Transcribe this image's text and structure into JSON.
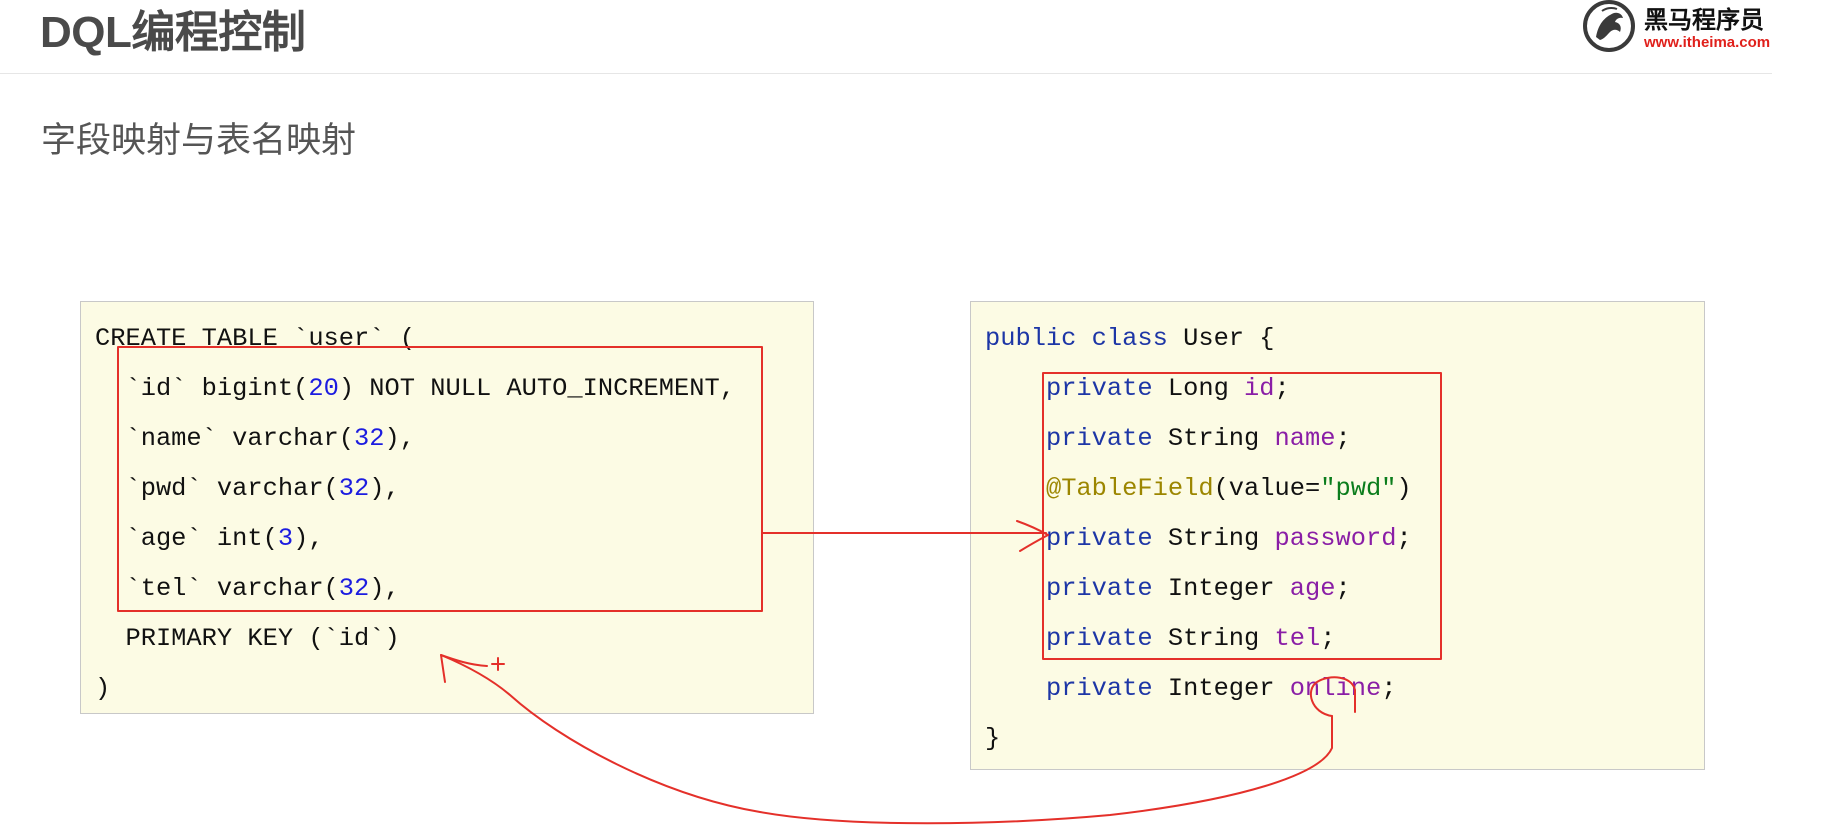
{
  "header": {
    "title": "DQL编程控制"
  },
  "logo": {
    "icon": "horse-logo-icon",
    "brand": "黑马程序员",
    "website": "www.itheima.com",
    "brand_color": "#111111",
    "website_color": "#e0201b"
  },
  "subtitle": "字段映射与表名映射",
  "colors": {
    "panel_background": "#fcfbe4",
    "annotation_red": "#e4302a",
    "keyword": "#1d36a6",
    "number": "#1c1ce0",
    "field": "#8a1ea6",
    "annotation": "#9c8600",
    "string": "#0b7d1c"
  },
  "sql_code": {
    "lines": [
      [
        {
          "text": "CREATE TABLE `user` ("
        }
      ],
      [
        {
          "text": "  `id` bigint("
        },
        {
          "text": "20",
          "color": "#1c1ce0"
        },
        {
          "text": ") NOT NULL AUTO_INCREMENT,"
        }
      ],
      [
        {
          "text": "  `name` varchar("
        },
        {
          "text": "32",
          "color": "#1c1ce0"
        },
        {
          "text": "),"
        }
      ],
      [
        {
          "text": "  `pwd` varchar("
        },
        {
          "text": "32",
          "color": "#1c1ce0"
        },
        {
          "text": "),"
        }
      ],
      [
        {
          "text": "  `age` int("
        },
        {
          "text": "3",
          "color": "#1c1ce0"
        },
        {
          "text": "),"
        }
      ],
      [
        {
          "text": "  `tel` varchar("
        },
        {
          "text": "32",
          "color": "#1c1ce0"
        },
        {
          "text": "),"
        }
      ],
      [
        {
          "text": "  PRIMARY KEY (`id`)"
        }
      ],
      [
        {
          "text": ")"
        }
      ]
    ]
  },
  "java_code": {
    "lines": [
      [
        {
          "text": "public",
          "color": "#1d36a6"
        },
        {
          "text": " "
        },
        {
          "text": "class",
          "color": "#1d36a6"
        },
        {
          "text": " User {"
        }
      ],
      [
        {
          "text": "    "
        },
        {
          "text": "private",
          "color": "#1d36a6"
        },
        {
          "text": " Long "
        },
        {
          "text": "id",
          "color": "#8a1ea6"
        },
        {
          "text": ";"
        }
      ],
      [
        {
          "text": "    "
        },
        {
          "text": "private",
          "color": "#1d36a6"
        },
        {
          "text": " String "
        },
        {
          "text": "name",
          "color": "#8a1ea6"
        },
        {
          "text": ";"
        }
      ],
      [
        {
          "text": "    "
        },
        {
          "text": "@TableField",
          "color": "#9c8600"
        },
        {
          "text": "(value="
        },
        {
          "text": "\"pwd\"",
          "color": "#0b7d1c"
        },
        {
          "text": ")"
        }
      ],
      [
        {
          "text": "    "
        },
        {
          "text": "private",
          "color": "#1d36a6"
        },
        {
          "text": " String "
        },
        {
          "text": "password",
          "color": "#8a1ea6"
        },
        {
          "text": ";"
        }
      ],
      [
        {
          "text": "    "
        },
        {
          "text": "private",
          "color": "#1d36a6"
        },
        {
          "text": " Integer "
        },
        {
          "text": "age",
          "color": "#8a1ea6"
        },
        {
          "text": ";"
        }
      ],
      [
        {
          "text": "    "
        },
        {
          "text": "private",
          "color": "#1d36a6"
        },
        {
          "text": " String "
        },
        {
          "text": "tel",
          "color": "#8a1ea6"
        },
        {
          "text": ";"
        }
      ],
      [
        {
          "text": "    "
        },
        {
          "text": "private",
          "color": "#1d36a6"
        },
        {
          "text": " Integer "
        },
        {
          "text": "online",
          "color": "#8a1ea6"
        },
        {
          "text": ";"
        }
      ],
      [
        {
          "text": "}"
        }
      ]
    ]
  }
}
